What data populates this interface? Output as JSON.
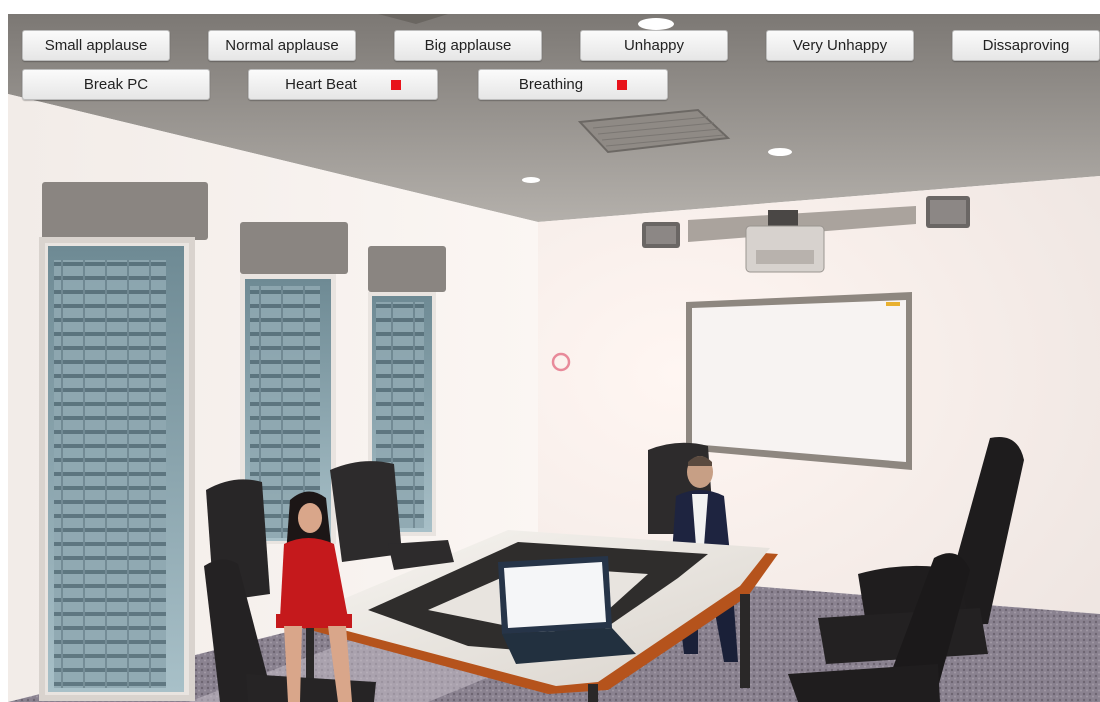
{
  "buttons_row1": [
    "Small applause",
    "Normal applause",
    "Big applause",
    "Unhappy",
    "Very Unhappy",
    "Dissaproving"
  ],
  "buttons_row2": {
    "break_pc": "Break PC",
    "heart_beat": "Heart Beat",
    "breathing": "Breathing"
  },
  "indicators": {
    "heart_beat_color": "#e8131b",
    "breathing_color": "#e8131b"
  },
  "scene": {
    "description_icon": "conference-room-3d-scene",
    "gaze_cursor_color": "#e88a9a"
  }
}
